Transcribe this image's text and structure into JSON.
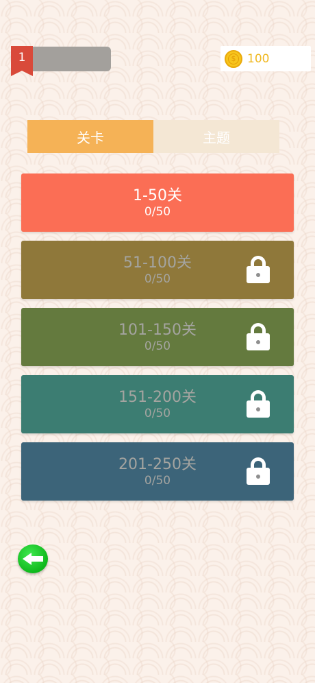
{
  "header": {
    "rank_number": "1",
    "coins": "100"
  },
  "tabs": [
    {
      "label": "关卡",
      "active": true
    },
    {
      "label": "主题",
      "active": false
    }
  ],
  "levels": [
    {
      "title": "1-50关",
      "progress": "0/50",
      "locked": false,
      "color": "#fb6e55"
    },
    {
      "title": "51-100关",
      "progress": "0/50",
      "locked": true,
      "color": "#8f783a"
    },
    {
      "title": "101-150关",
      "progress": "0/50",
      "locked": true,
      "color": "#647a3e"
    },
    {
      "title": "151-200关",
      "progress": "0/50",
      "locked": true,
      "color": "#3c7d72"
    },
    {
      "title": "201-250关",
      "progress": "0/50",
      "locked": true,
      "color": "#3c6479"
    }
  ],
  "colors": {
    "background": "#fbf1ea",
    "tab_active": "#f5b256",
    "tab_inactive": "#f4e7d4",
    "coin": "#f7c51c",
    "back_button": "#12bf20"
  },
  "icons": {
    "rank": "ribbon-badge-icon",
    "coin": "coin-icon",
    "lock": "lock-icon",
    "back": "back-arrow-icon"
  }
}
